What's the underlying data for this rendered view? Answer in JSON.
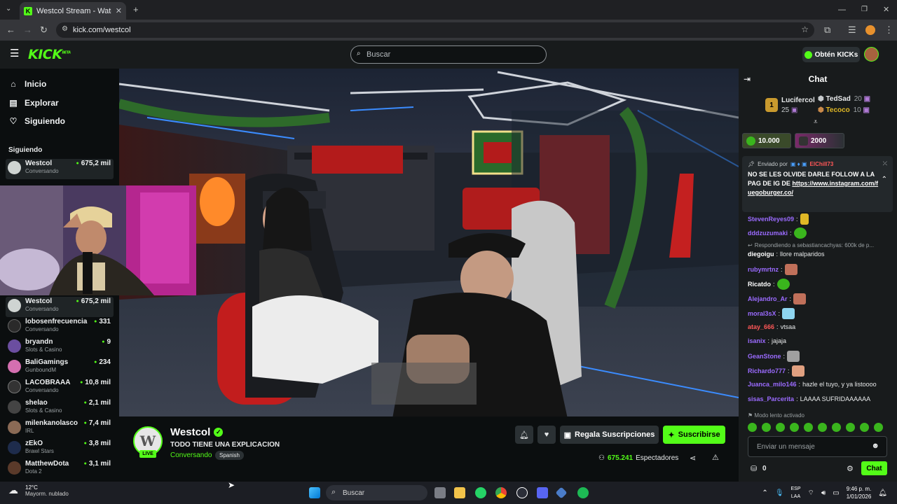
{
  "browser": {
    "tab_title": "Westcol Stream - Watch Li...",
    "tab_close": "✕",
    "url": "kick.com/westcol",
    "new_tab": "+"
  },
  "header": {
    "logo": "KICK",
    "logo_badge": "BETA",
    "search_placeholder": "Buscar",
    "kicks_button": "Obtén KICKs"
  },
  "sidebar": {
    "nav": [
      {
        "label": "Inicio",
        "icon": "home-icon"
      },
      {
        "label": "Explorar",
        "icon": "explore-icon"
      },
      {
        "label": "Siguiendo",
        "icon": "heart-icon"
      }
    ],
    "following_header": "Siguiendo",
    "following": [
      {
        "name": "Westcol",
        "category": "Conversando",
        "viewers": "675,2 mil"
      }
    ],
    "recommended": [
      {
        "name": "Westcol",
        "category": "Conversando",
        "viewers": "675,2 mil",
        "color": "#cfd4d2"
      },
      {
        "name": "lobosenfrecuencia",
        "category": "Conversando",
        "viewers": "331",
        "color": "#2a2a2a"
      },
      {
        "name": "bryandn",
        "category": "Slots & Casino",
        "viewers": "9",
        "color": "#6b4ea0"
      },
      {
        "name": "BaliGamings",
        "category": "GunboundM",
        "viewers": "234",
        "color": "#d46fb0"
      },
      {
        "name": "LACOBRAAA",
        "category": "Conversando",
        "viewers": "10,8 mil",
        "color": "#333333"
      },
      {
        "name": "shelao",
        "category": "Slots & Casino",
        "viewers": "2,1 mil",
        "color": "#444444"
      },
      {
        "name": "milenkanolasco",
        "category": "IRL",
        "viewers": "7,4 mil",
        "color": "#8a6a55"
      },
      {
        "name": "zEkO",
        "category": "Brawl Stars",
        "viewers": "3,8 mil",
        "color": "#1e2c4c"
      },
      {
        "name": "MatthewDota",
        "category": "Dota 2",
        "viewers": "3,1 mil",
        "color": "#5a3a2a"
      }
    ]
  },
  "stream": {
    "channel": "Westcol",
    "live_badge": "LIVE",
    "title": "TODO TIENE UNA EXPLICACION",
    "category": "Conversando",
    "language": "Spanish",
    "gift_button": "Regala Suscripciones",
    "subscribe_button": "Suscribirse",
    "viewers_count": "675.241",
    "viewers_label": "Espectadores"
  },
  "chat": {
    "title": "Chat",
    "leaderboard": [
      {
        "rank": "1",
        "name": "Lucifercol",
        "count": "25"
      },
      {
        "name": "TedSad",
        "count": "20"
      },
      {
        "name": "Tecoco",
        "count": "10"
      }
    ],
    "gift_goals": [
      "10.000",
      "2000"
    ],
    "pinned": {
      "sent_by": "Enviado por",
      "sender": "ElChill73",
      "message": "NO SE LES OLVIDE DARLE FOLLOW A LA PAG DE IG DE",
      "link": "https://www.instagram.com/fuegoburger.co/"
    },
    "messages": [
      {
        "user": "StevenReyes09",
        "text": "",
        "color": "#9b6bff",
        "emote": "#e0b826"
      },
      {
        "user": "dddzuzumaki",
        "text": "",
        "color": "#9b6bff",
        "emote": "#3ab51d"
      },
      {
        "user": "",
        "text": "Respondiendo a sebastiancachyas: 600k de p...",
        "color": "#9aa0a3",
        "emote": ""
      },
      {
        "user": "diegoigu",
        "text": "llore malparidos",
        "color": "#ffffff",
        "emote": ""
      },
      {
        "user": "rubymrtnz",
        "text": "",
        "color": "#9b6bff",
        "emote": "#c0705a"
      },
      {
        "user": "Ricatdo",
        "text": "",
        "color": "#ffffff",
        "emote": "#3ab51d"
      },
      {
        "user": "Alejandro_Ar",
        "text": "",
        "color": "#9b6bff",
        "emote": "#c0705a"
      },
      {
        "user": "moral3sX",
        "text": "",
        "color": "#9b6bff",
        "emote": "#8fd6f0"
      },
      {
        "user": "atay_666",
        "text": "vtsaa",
        "color": "#ff5757",
        "emote": ""
      },
      {
        "user": "isanix",
        "text": "jajaja",
        "color": "#9b6bff",
        "emote": ""
      },
      {
        "user": "GeanStone",
        "text": "",
        "color": "#9b6bff",
        "emote": "#a0a0a0"
      },
      {
        "user": "Richardo777",
        "text": "",
        "color": "#9b6bff",
        "emote": "#e0a080"
      },
      {
        "user": "Juanca_milo146",
        "text": "hazle el tuyo, y ya listoooo",
        "color": "#9b6bff",
        "emote": ""
      },
      {
        "user": "sisas_Parcerita",
        "text": "LAAAA SUFRIDAAAAAA",
        "color": "#9b6bff",
        "emote": ""
      }
    ],
    "slow_mode": "Modo lento activado",
    "input_placeholder": "Enviar un mensaje",
    "points": "0",
    "send_button": "Chat"
  },
  "taskbar": {
    "temperature": "12°C",
    "weather": "Mayorm. nublado",
    "search": "Buscar",
    "lang_line1": "ESP",
    "lang_line2": "LAA",
    "time": "9:46 p. m.",
    "date": "1/01/2026"
  },
  "colors": {
    "accent": "#53fc18",
    "bg": "#0b0e0f",
    "panel": "#181b1c"
  }
}
